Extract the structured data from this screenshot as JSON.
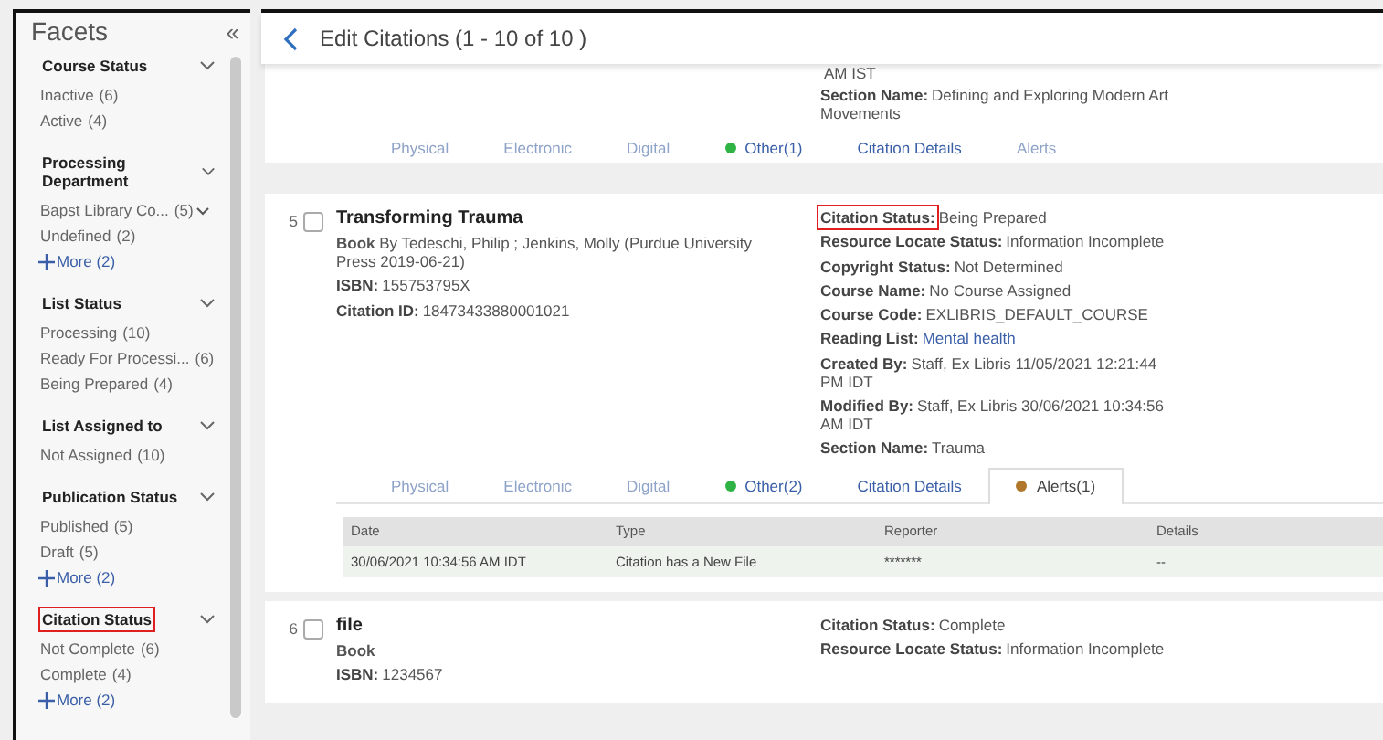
{
  "sidebar": {
    "title": "Facets",
    "collapse_icon": "«",
    "groups": [
      {
        "heading": "Course Status",
        "highlighted": false,
        "items": [
          {
            "label": "Inactive",
            "count": "(6)"
          },
          {
            "label": "Active",
            "count": "(4)"
          }
        ]
      },
      {
        "heading": "Processing Department",
        "highlighted": false,
        "items": [
          {
            "label": "Bapst Library Co...",
            "count": "(5)",
            "caret": true
          },
          {
            "label": "Undefined",
            "count": "(2)"
          }
        ],
        "more": "More (2)"
      },
      {
        "heading": "List Status",
        "highlighted": false,
        "items": [
          {
            "label": "Processing",
            "count": "(10)"
          },
          {
            "label": "Ready For Processi...",
            "count": "(6)"
          },
          {
            "label": "Being Prepared",
            "count": "(4)"
          }
        ]
      },
      {
        "heading": "List Assigned to",
        "highlighted": false,
        "items": [
          {
            "label": "Not Assigned",
            "count": "(10)"
          }
        ]
      },
      {
        "heading": "Publication Status",
        "highlighted": false,
        "items": [
          {
            "label": "Published",
            "count": "(5)"
          },
          {
            "label": "Draft",
            "count": "(5)"
          }
        ],
        "more": "More (2)"
      },
      {
        "heading": "Citation Status",
        "highlighted": true,
        "items": [
          {
            "label": "Not Complete",
            "count": "(6)"
          },
          {
            "label": "Complete",
            "count": "(4)"
          }
        ],
        "more": "More (2)"
      }
    ]
  },
  "header": {
    "title": "Edit Citations (1 - 10 of 10 )"
  },
  "records": [
    {
      "partial": true,
      "right_fields": [
        {
          "value": "AM IST"
        },
        {
          "label": "Section Name:",
          "value": "Defining and Exploring Modern Art",
          "value_cont": "Movements"
        }
      ],
      "tabs": [
        {
          "label": "Physical",
          "disabled": true,
          "selected": false
        },
        {
          "label": "Electronic",
          "disabled": true,
          "selected": false
        },
        {
          "label": "Digital",
          "disabled": true,
          "selected": false
        },
        {
          "label": "Other(1)",
          "disabled": false,
          "selected": false,
          "color": "#2fb344"
        },
        {
          "label": "Citation Details",
          "disabled": false,
          "selected": false
        },
        {
          "label": "Alerts",
          "disabled": true,
          "selected": false
        }
      ]
    },
    {
      "number": "5",
      "checked": false,
      "title": "Transforming Trauma",
      "byline": "**Book** By Tedeschi, Philip ; Jenkins, Molly (Purdue University Press 2019-06-21)",
      "left_fields": [
        {
          "label": "ISBN:",
          "value": "155753795X"
        },
        {
          "label": "Citation ID:",
          "value": "18473433880001021"
        }
      ],
      "right_fields": [
        {
          "label": "Citation Status:",
          "value": "Being Prepared",
          "highlighted": true
        },
        {
          "label": "Resource Locate Status:",
          "value": "Information Incomplete"
        },
        {
          "label": "Copyright Status:",
          "value": "Not Determined"
        },
        {
          "label": "Course Name:",
          "value": "No Course Assigned"
        },
        {
          "label": "Course Code:",
          "value": "EXLIBRIS_DEFAULT_COURSE"
        },
        {
          "label": "Reading List:",
          "value": "Mental health",
          "link": true
        },
        {
          "label": "Created By:",
          "value": "Staff, Ex Libris 11/05/2021 12:21:44",
          "value_cont": "PM IDT"
        },
        {
          "label": "Modified By:",
          "value": "Staff, Ex Libris 30/06/2021 10:34:56",
          "value_cont": "AM IDT"
        },
        {
          "label": "Section Name:",
          "value": "Trauma"
        }
      ],
      "tabs": [
        {
          "label": "Physical",
          "disabled": true,
          "selected": false
        },
        {
          "label": "Electronic",
          "disabled": true,
          "selected": false
        },
        {
          "label": "Digital",
          "disabled": true,
          "selected": false
        },
        {
          "label": "Other(2)",
          "disabled": false,
          "selected": false,
          "color": "#2fb344"
        },
        {
          "label": "Citation Details",
          "disabled": false,
          "selected": false
        },
        {
          "label": "Alerts(1)",
          "disabled": false,
          "selected": true,
          "color": "#b0772a"
        }
      ],
      "table": {
        "columns": [
          "Date",
          "Type",
          "Reporter",
          "Details"
        ],
        "rows": [
          [
            "30/06/2021 10:34:56 AM IDT",
            "Citation has a New File",
            "*******",
            "--"
          ]
        ]
      }
    },
    {
      "number": "6",
      "checked": false,
      "title": "file",
      "byline": "**Book**",
      "left_fields": [
        {
          "label": "ISBN:",
          "value": "1234567"
        }
      ],
      "right_fields": [
        {
          "label": "Citation Status:",
          "value": "Complete"
        },
        {
          "label": "Resource Locate Status:",
          "value": "Information Incomplete"
        }
      ]
    }
  ]
}
